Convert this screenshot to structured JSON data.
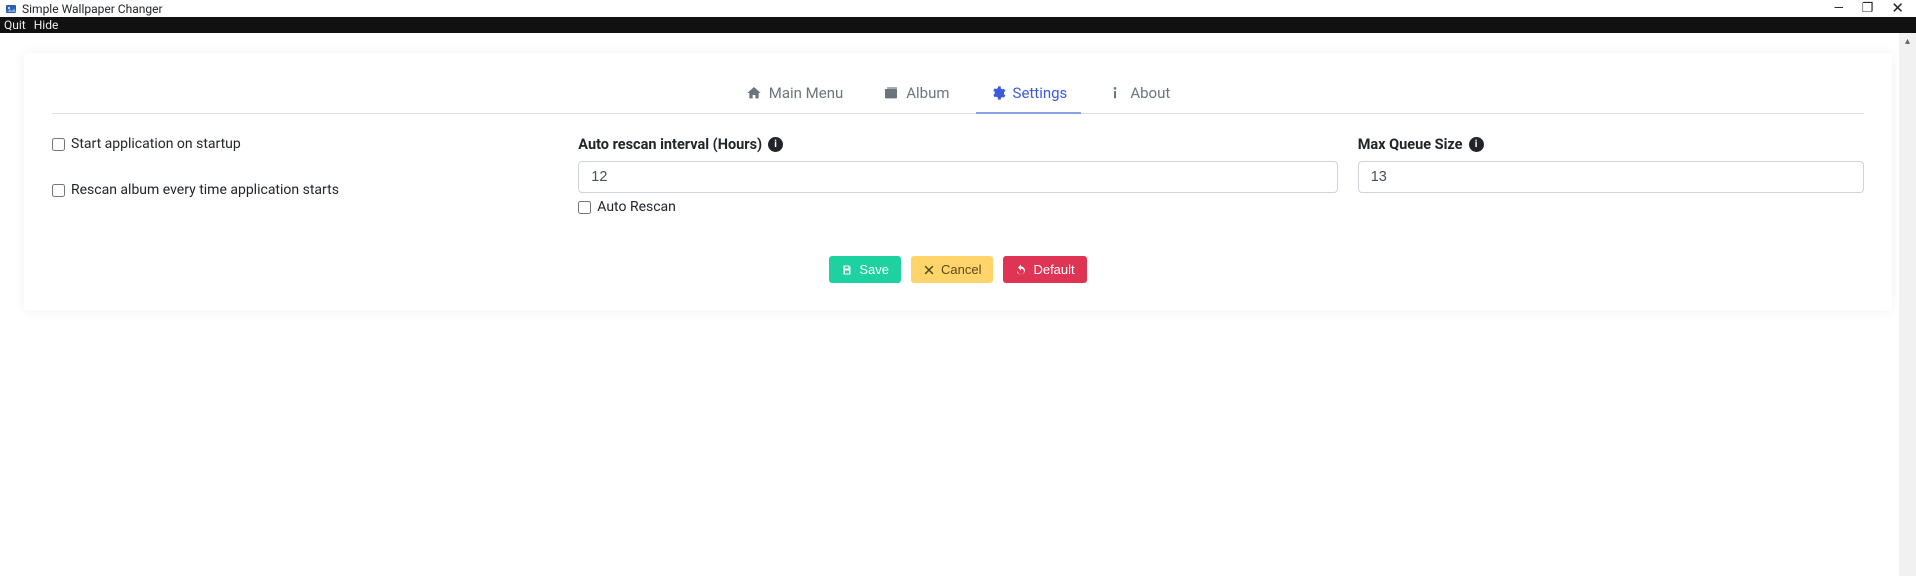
{
  "window": {
    "title": "Simple Wallpaper Changer"
  },
  "menu": {
    "quit": "Quit",
    "hide": "Hide"
  },
  "tabs": {
    "main": "Main Menu",
    "album": "Album",
    "settings": "Settings",
    "about": "About"
  },
  "settings": {
    "startup_label": "Start application on startup",
    "rescan_startup_label": "Rescan album every time application starts",
    "rescan_interval_label": "Auto rescan interval (Hours)",
    "rescan_interval_value": "12",
    "auto_rescan_label": "Auto Rescan",
    "max_queue_label": "Max Queue Size",
    "max_queue_value": "13"
  },
  "buttons": {
    "save": "Save",
    "cancel": "Cancel",
    "default": "Default"
  }
}
